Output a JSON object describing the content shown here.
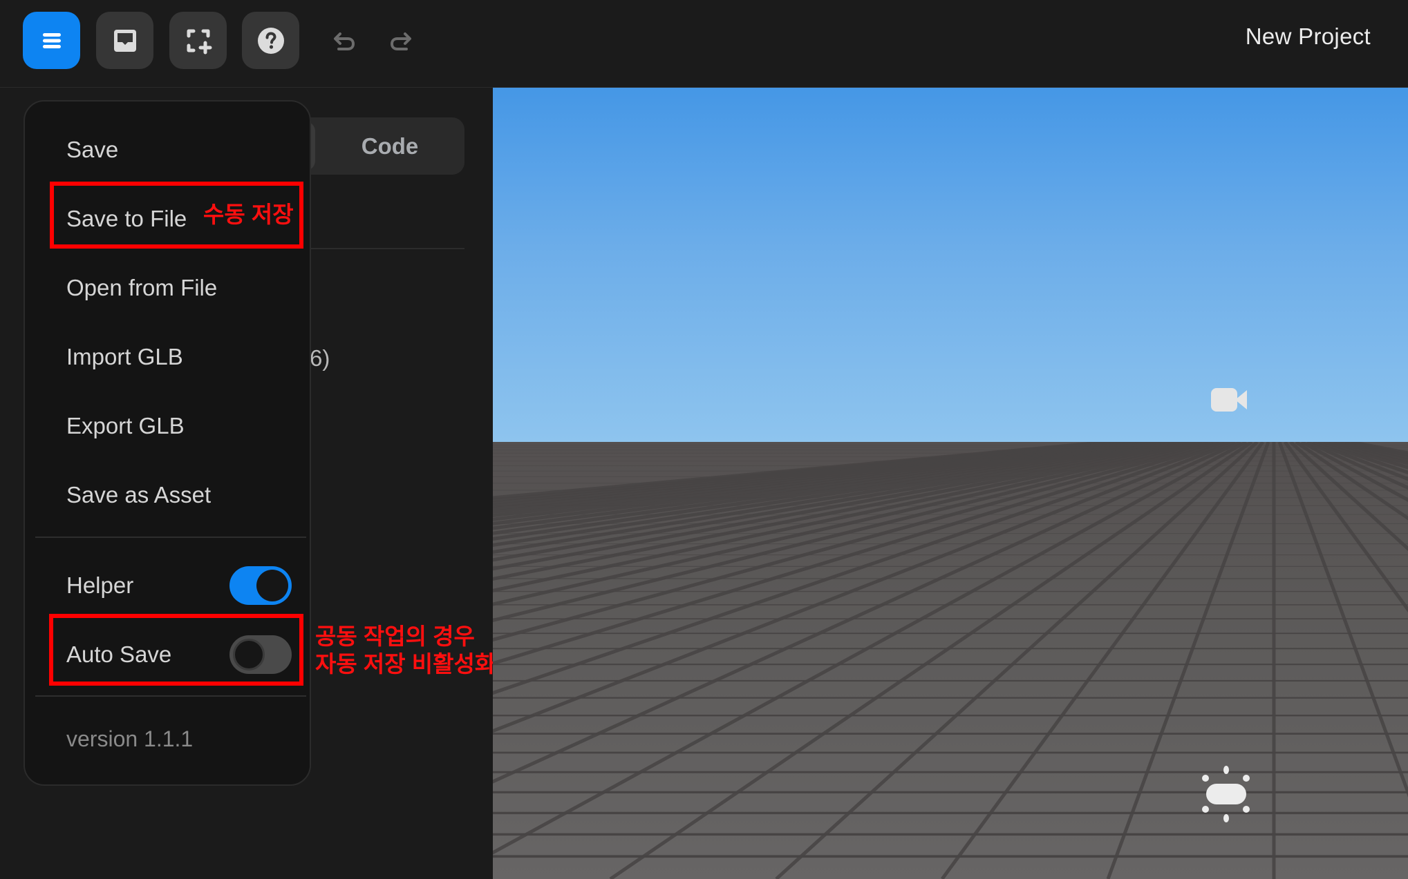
{
  "header": {
    "project_title": "New Project",
    "buttons": [
      {
        "name": "menu-button",
        "icon": "hamburger-menu-icon",
        "active": true
      },
      {
        "name": "inbox-button",
        "icon": "inbox-tray-icon",
        "active": false
      },
      {
        "name": "add-frame-button",
        "icon": "frame-add-icon",
        "active": false
      },
      {
        "name": "help-button",
        "icon": "help-question-icon",
        "active": false
      }
    ],
    "undo_icon": "undo-arrow-icon",
    "redo_icon": "redo-arrow-icon"
  },
  "left_panel": {
    "tabs": [
      {
        "label": "",
        "selected": true
      },
      {
        "label": "Code",
        "selected": false
      }
    ],
    "partial_text": "6)"
  },
  "menu": {
    "items": [
      {
        "label": "Save"
      },
      {
        "label": "Save to File"
      },
      {
        "label": "Open from File"
      },
      {
        "label": "Import GLB"
      },
      {
        "label": "Export GLB"
      },
      {
        "label": "Save as Asset"
      }
    ],
    "toggles": [
      {
        "label": "Helper",
        "on": true
      },
      {
        "label": "Auto Save",
        "on": false
      }
    ],
    "version": "version 1.1.1"
  },
  "annotations": {
    "save_to_file_note": "수동 저장",
    "auto_save_note_line1": "공동 작업의 경우",
    "auto_save_note_line2": "자동 저장 비활성화",
    "color": "#ff0000"
  },
  "viewport": {
    "camera_icon": "video-camera-icon",
    "light_icon": "light-bulb-icon",
    "sky_color": "#4597e6",
    "ground_color": "#5c5a59"
  },
  "colors": {
    "accent": "#0d84f2",
    "background": "#1b1b1b",
    "menu_bg": "#141414"
  }
}
